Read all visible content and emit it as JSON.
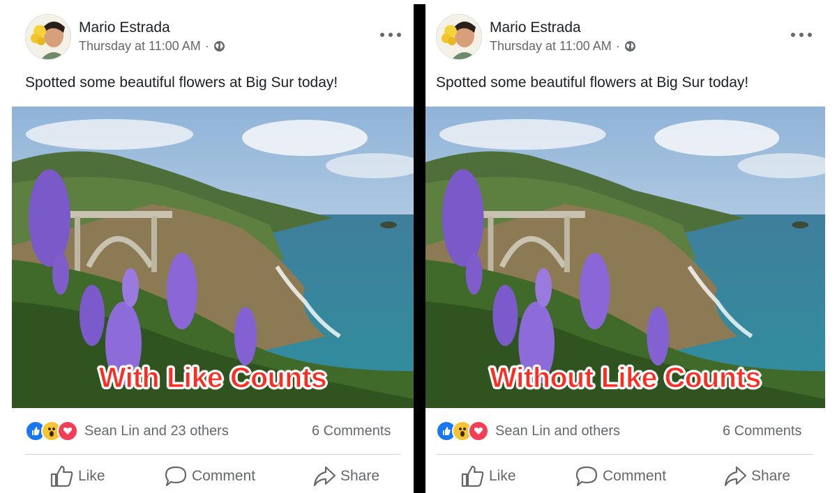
{
  "posts": [
    {
      "author": "Mario Estrada",
      "time": "Thursday at 11:00 AM",
      "separator": "·",
      "text": "Spotted some beautiful flowers at Big Sur today!",
      "overlay_label": "With Like Counts",
      "reactions_text": "Sean Lin and 23 others",
      "comments": "6 Comments",
      "actions": {
        "like": "Like",
        "comment": "Comment",
        "share": "Share"
      }
    },
    {
      "author": "Mario Estrada",
      "time": "Thursday at 11:00 AM",
      "separator": "·",
      "text": "Spotted some beautiful flowers at Big Sur today!",
      "overlay_label": "Without Like Counts",
      "reactions_text": "Sean Lin and others",
      "comments": "6 Comments",
      "actions": {
        "like": "Like",
        "comment": "Comment",
        "share": "Share"
      }
    }
  ],
  "icons": [
    "more-options-icon",
    "globe-icon",
    "like-reaction-icon",
    "wow-reaction-icon",
    "love-reaction-icon",
    "thumbs-up-icon",
    "comment-icon",
    "share-icon"
  ],
  "colors": {
    "overlay_text": "#ff2a20",
    "like_blue": "#1877f2",
    "love_red": "#f33e58",
    "wow_yellow": "#f7c533",
    "secondary_text": "#65676b"
  }
}
